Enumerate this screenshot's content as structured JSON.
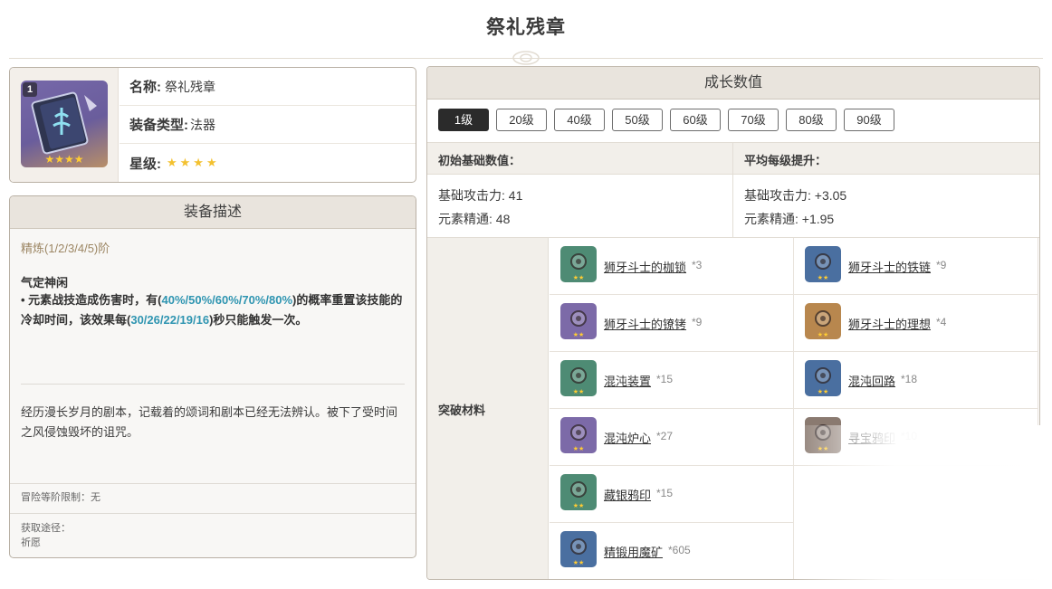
{
  "page": {
    "title": "祭礼残章"
  },
  "info": {
    "badge": "1",
    "thumb_stars": "★★★★",
    "name_key": "名称:",
    "name_val": "祭礼残章",
    "type_key": "装备类型:",
    "type_val": "法器",
    "rarity_key": "星级:",
    "rarity_stars": "★★★★"
  },
  "description": {
    "header": "装备描述",
    "refine": "精炼(1/2/3/4/5)阶",
    "skill_name": "气定神闲",
    "skill_prefix": "• 元素战技造成伤害时，有(",
    "skill_chance": "40%/50%/60%/70%/80%",
    "skill_mid": ")的概率重置该技能的冷却时间，该效果每(",
    "skill_cd": "30/26/22/19/16",
    "skill_suffix": ")秒只能触发一次。",
    "lore": "经历漫长岁月的剧本，记载着的颂词和剧本已经无法辨认。被下了受时间之风侵蚀毁坏的诅咒。",
    "ar_limit": "冒险等阶限制：无",
    "source_label": "获取途径：",
    "source_value": "祈愿"
  },
  "growth": {
    "header": "成长数值",
    "levels": [
      "1级",
      "20级",
      "40级",
      "50级",
      "60级",
      "70级",
      "80级",
      "90级"
    ],
    "active_level": "1级",
    "base_header": "初始基础数值：",
    "avg_header": "平均每级提升：",
    "base_atk": "基础攻击力: 41",
    "base_em": "元素精通: 48",
    "avg_atk": "基础攻击力: +3.05",
    "avg_em": "元素精通: +1.95",
    "materials_label": "突破材料",
    "materials": [
      {
        "name": "狮牙斗士的枷锁",
        "qty": "*3",
        "icon": "shackle-icon",
        "color": "#4e8b74"
      },
      {
        "name": "狮牙斗士的铁链",
        "qty": "*9",
        "icon": "chain-icon",
        "color": "#4a6fa0"
      },
      {
        "name": "狮牙斗士的镣铐",
        "qty": "*9",
        "icon": "fetter-icon",
        "color": "#7c6aa8"
      },
      {
        "name": "狮牙斗士的理想",
        "qty": "*4",
        "icon": "ideal-icon",
        "color": "#b8874e"
      },
      {
        "name": "混沌装置",
        "qty": "*15",
        "icon": "chaos-device-icon",
        "color": "#4e8b74"
      },
      {
        "name": "混沌回路",
        "qty": "*18",
        "icon": "chaos-circuit-icon",
        "color": "#4a6fa0"
      },
      {
        "name": "混沌炉心",
        "qty": "*27",
        "icon": "chaos-core-icon",
        "color": "#7c6aa8"
      },
      {
        "name": "寻宝鸦印",
        "qty": "*10",
        "icon": "crow-insignia-icon",
        "color": "#8a7a70"
      },
      {
        "name": "藏银鸦印",
        "qty": "*15",
        "icon": "silver-insignia-icon",
        "color": "#4e8b74"
      },
      {
        "name": "精锻用魔矿",
        "qty": "*605",
        "icon": "crystal-ore-icon",
        "color": "#4a6fa0"
      }
    ]
  }
}
